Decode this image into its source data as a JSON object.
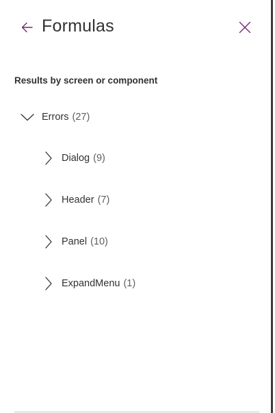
{
  "header": {
    "title": "Formulas",
    "back_icon": "arrow-left-icon",
    "close_icon": "close-icon",
    "accent_color": "#742774"
  },
  "section": {
    "label": "Results by screen or component"
  },
  "tree": {
    "root": {
      "label": "Errors",
      "count": "(27)",
      "expanded": true
    },
    "children": [
      {
        "label": "Dialog",
        "count": "(9)"
      },
      {
        "label": "Header",
        "count": "(7)"
      },
      {
        "label": "Panel",
        "count": "(10)"
      },
      {
        "label": "ExpandMenu",
        "count": "(1)"
      }
    ]
  }
}
